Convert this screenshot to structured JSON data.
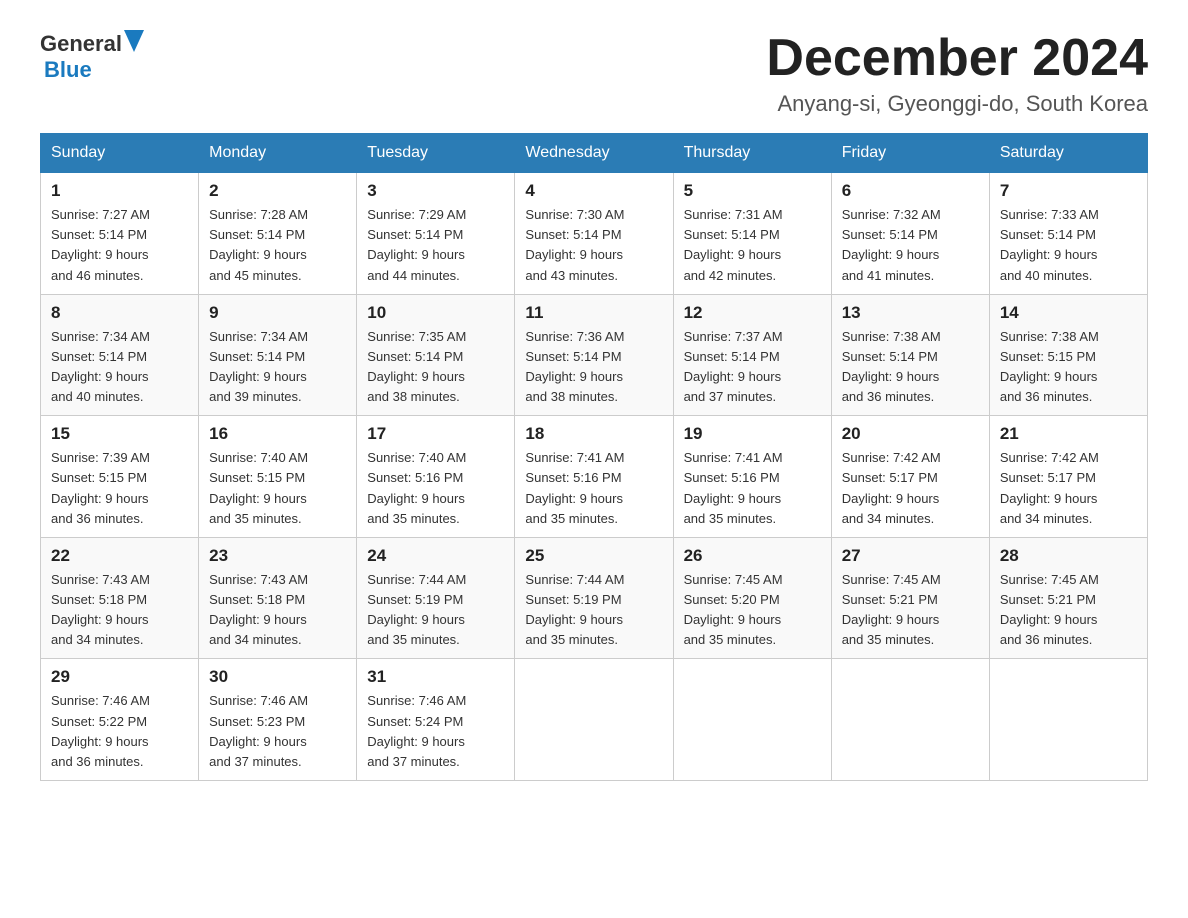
{
  "header": {
    "logo_general": "General",
    "logo_blue": "Blue",
    "title": "December 2024",
    "subtitle": "Anyang-si, Gyeonggi-do, South Korea"
  },
  "days_of_week": [
    "Sunday",
    "Monday",
    "Tuesday",
    "Wednesday",
    "Thursday",
    "Friday",
    "Saturday"
  ],
  "weeks": [
    [
      {
        "day": "1",
        "sunrise": "7:27 AM",
        "sunset": "5:14 PM",
        "daylight": "9 hours and 46 minutes."
      },
      {
        "day": "2",
        "sunrise": "7:28 AM",
        "sunset": "5:14 PM",
        "daylight": "9 hours and 45 minutes."
      },
      {
        "day": "3",
        "sunrise": "7:29 AM",
        "sunset": "5:14 PM",
        "daylight": "9 hours and 44 minutes."
      },
      {
        "day": "4",
        "sunrise": "7:30 AM",
        "sunset": "5:14 PM",
        "daylight": "9 hours and 43 minutes."
      },
      {
        "day": "5",
        "sunrise": "7:31 AM",
        "sunset": "5:14 PM",
        "daylight": "9 hours and 42 minutes."
      },
      {
        "day": "6",
        "sunrise": "7:32 AM",
        "sunset": "5:14 PM",
        "daylight": "9 hours and 41 minutes."
      },
      {
        "day": "7",
        "sunrise": "7:33 AM",
        "sunset": "5:14 PM",
        "daylight": "9 hours and 40 minutes."
      }
    ],
    [
      {
        "day": "8",
        "sunrise": "7:34 AM",
        "sunset": "5:14 PM",
        "daylight": "9 hours and 40 minutes."
      },
      {
        "day": "9",
        "sunrise": "7:34 AM",
        "sunset": "5:14 PM",
        "daylight": "9 hours and 39 minutes."
      },
      {
        "day": "10",
        "sunrise": "7:35 AM",
        "sunset": "5:14 PM",
        "daylight": "9 hours and 38 minutes."
      },
      {
        "day": "11",
        "sunrise": "7:36 AM",
        "sunset": "5:14 PM",
        "daylight": "9 hours and 38 minutes."
      },
      {
        "day": "12",
        "sunrise": "7:37 AM",
        "sunset": "5:14 PM",
        "daylight": "9 hours and 37 minutes."
      },
      {
        "day": "13",
        "sunrise": "7:38 AM",
        "sunset": "5:14 PM",
        "daylight": "9 hours and 36 minutes."
      },
      {
        "day": "14",
        "sunrise": "7:38 AM",
        "sunset": "5:15 PM",
        "daylight": "9 hours and 36 minutes."
      }
    ],
    [
      {
        "day": "15",
        "sunrise": "7:39 AM",
        "sunset": "5:15 PM",
        "daylight": "9 hours and 36 minutes."
      },
      {
        "day": "16",
        "sunrise": "7:40 AM",
        "sunset": "5:15 PM",
        "daylight": "9 hours and 35 minutes."
      },
      {
        "day": "17",
        "sunrise": "7:40 AM",
        "sunset": "5:16 PM",
        "daylight": "9 hours and 35 minutes."
      },
      {
        "day": "18",
        "sunrise": "7:41 AM",
        "sunset": "5:16 PM",
        "daylight": "9 hours and 35 minutes."
      },
      {
        "day": "19",
        "sunrise": "7:41 AM",
        "sunset": "5:16 PM",
        "daylight": "9 hours and 35 minutes."
      },
      {
        "day": "20",
        "sunrise": "7:42 AM",
        "sunset": "5:17 PM",
        "daylight": "9 hours and 34 minutes."
      },
      {
        "day": "21",
        "sunrise": "7:42 AM",
        "sunset": "5:17 PM",
        "daylight": "9 hours and 34 minutes."
      }
    ],
    [
      {
        "day": "22",
        "sunrise": "7:43 AM",
        "sunset": "5:18 PM",
        "daylight": "9 hours and 34 minutes."
      },
      {
        "day": "23",
        "sunrise": "7:43 AM",
        "sunset": "5:18 PM",
        "daylight": "9 hours and 34 minutes."
      },
      {
        "day": "24",
        "sunrise": "7:44 AM",
        "sunset": "5:19 PM",
        "daylight": "9 hours and 35 minutes."
      },
      {
        "day": "25",
        "sunrise": "7:44 AM",
        "sunset": "5:19 PM",
        "daylight": "9 hours and 35 minutes."
      },
      {
        "day": "26",
        "sunrise": "7:45 AM",
        "sunset": "5:20 PM",
        "daylight": "9 hours and 35 minutes."
      },
      {
        "day": "27",
        "sunrise": "7:45 AM",
        "sunset": "5:21 PM",
        "daylight": "9 hours and 35 minutes."
      },
      {
        "day": "28",
        "sunrise": "7:45 AM",
        "sunset": "5:21 PM",
        "daylight": "9 hours and 36 minutes."
      }
    ],
    [
      {
        "day": "29",
        "sunrise": "7:46 AM",
        "sunset": "5:22 PM",
        "daylight": "9 hours and 36 minutes."
      },
      {
        "day": "30",
        "sunrise": "7:46 AM",
        "sunset": "5:23 PM",
        "daylight": "9 hours and 37 minutes."
      },
      {
        "day": "31",
        "sunrise": "7:46 AM",
        "sunset": "5:24 PM",
        "daylight": "9 hours and 37 minutes."
      },
      null,
      null,
      null,
      null
    ]
  ],
  "labels": {
    "sunrise": "Sunrise:",
    "sunset": "Sunset:",
    "daylight": "Daylight:"
  }
}
